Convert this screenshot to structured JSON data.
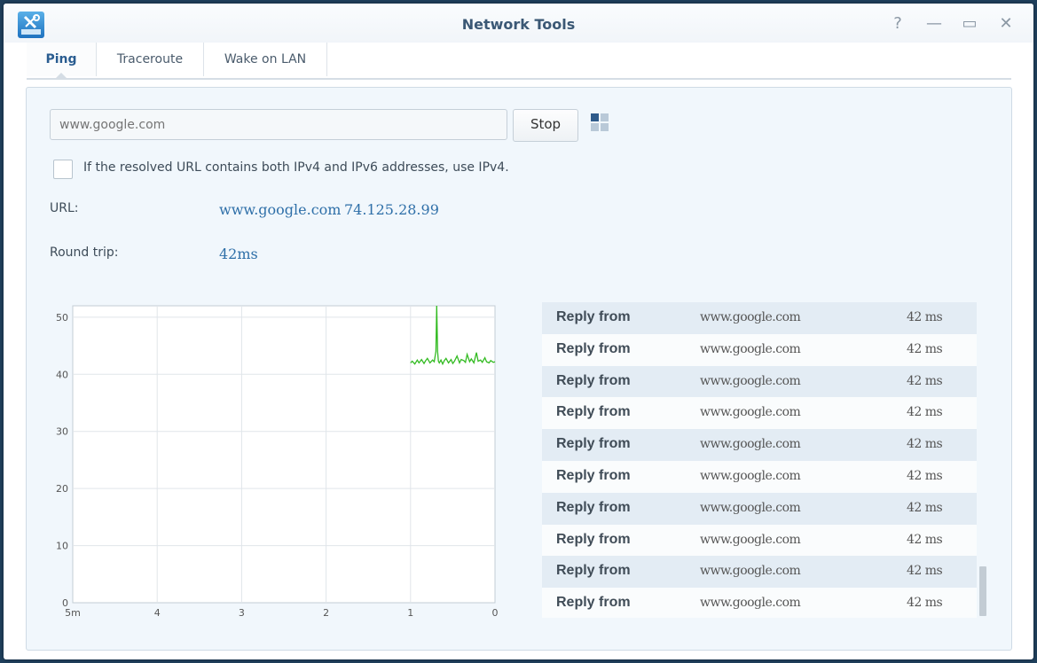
{
  "window": {
    "title": "Network Tools",
    "controls": {
      "help": "?",
      "minimize": "—",
      "maximize": "▭",
      "close": "✕"
    }
  },
  "tabs": [
    {
      "label": "Ping",
      "active": true
    },
    {
      "label": "Traceroute",
      "active": false
    },
    {
      "label": "Wake on LAN",
      "active": false
    }
  ],
  "ping": {
    "host_input": {
      "value": "www.google.com",
      "placeholder": "www.google.com"
    },
    "stop_label": "Stop",
    "ipv4_checkbox": {
      "checked": false,
      "label": "If the resolved URL contains both IPv4 and IPv6 addresses, use IPv4."
    },
    "url_label": "URL:",
    "url_host": "www.google.com",
    "url_ip": "74.125.28.99",
    "round_trip_label": "Round trip:",
    "round_trip_value": "42ms"
  },
  "colors": {
    "accent": "#2e6fa8",
    "series": "#33bb22"
  },
  "chart_data": {
    "type": "line",
    "xlim": [
      5,
      0
    ],
    "ylim": [
      0,
      52
    ],
    "x_tick_labels": [
      "5m",
      "4",
      "3",
      "2",
      "1",
      "0"
    ],
    "y_tick_labels": [
      "0",
      "10",
      "20",
      "30",
      "40",
      "50"
    ],
    "grid": true,
    "series": [
      {
        "x": [
          1.0,
          0.98,
          0.95,
          0.92,
          0.9,
          0.87,
          0.84,
          0.82,
          0.8,
          0.77,
          0.74,
          0.72,
          0.7,
          0.69,
          0.68,
          0.67,
          0.66,
          0.64,
          0.62,
          0.6,
          0.58,
          0.55,
          0.52,
          0.5,
          0.48,
          0.45,
          0.42,
          0.4,
          0.37,
          0.35,
          0.33,
          0.3,
          0.28,
          0.25,
          0.22,
          0.2,
          0.17,
          0.15,
          0.12,
          0.1,
          0.07,
          0.05,
          0.02,
          0.0
        ],
        "y": [
          42,
          42.3,
          41.8,
          42.5,
          42,
          42.6,
          41.9,
          42.4,
          42.8,
          42,
          42.5,
          42.2,
          44,
          52,
          44,
          42.3,
          42,
          42.5,
          41.8,
          42.4,
          42.8,
          42,
          42.6,
          41.9,
          42.3,
          43.2,
          42,
          42.6,
          42.4,
          42.1,
          43.5,
          42.2,
          42.7,
          42,
          43.8,
          42.3,
          42.5,
          42.1,
          42.9,
          42.2,
          42,
          42.4,
          42.1,
          42.2
        ]
      }
    ]
  },
  "reply_list": [
    {
      "label": "Reply from",
      "host": "www.google.com",
      "time": "42 ms"
    },
    {
      "label": "Reply from",
      "host": "www.google.com",
      "time": "42 ms"
    },
    {
      "label": "Reply from",
      "host": "www.google.com",
      "time": "42 ms"
    },
    {
      "label": "Reply from",
      "host": "www.google.com",
      "time": "42 ms"
    },
    {
      "label": "Reply from",
      "host": "www.google.com",
      "time": "42 ms"
    },
    {
      "label": "Reply from",
      "host": "www.google.com",
      "time": "42 ms"
    },
    {
      "label": "Reply from",
      "host": "www.google.com",
      "time": "42 ms"
    },
    {
      "label": "Reply from",
      "host": "www.google.com",
      "time": "42 ms"
    },
    {
      "label": "Reply from",
      "host": "www.google.com",
      "time": "42 ms"
    },
    {
      "label": "Reply from",
      "host": "www.google.com",
      "time": "42 ms"
    }
  ]
}
